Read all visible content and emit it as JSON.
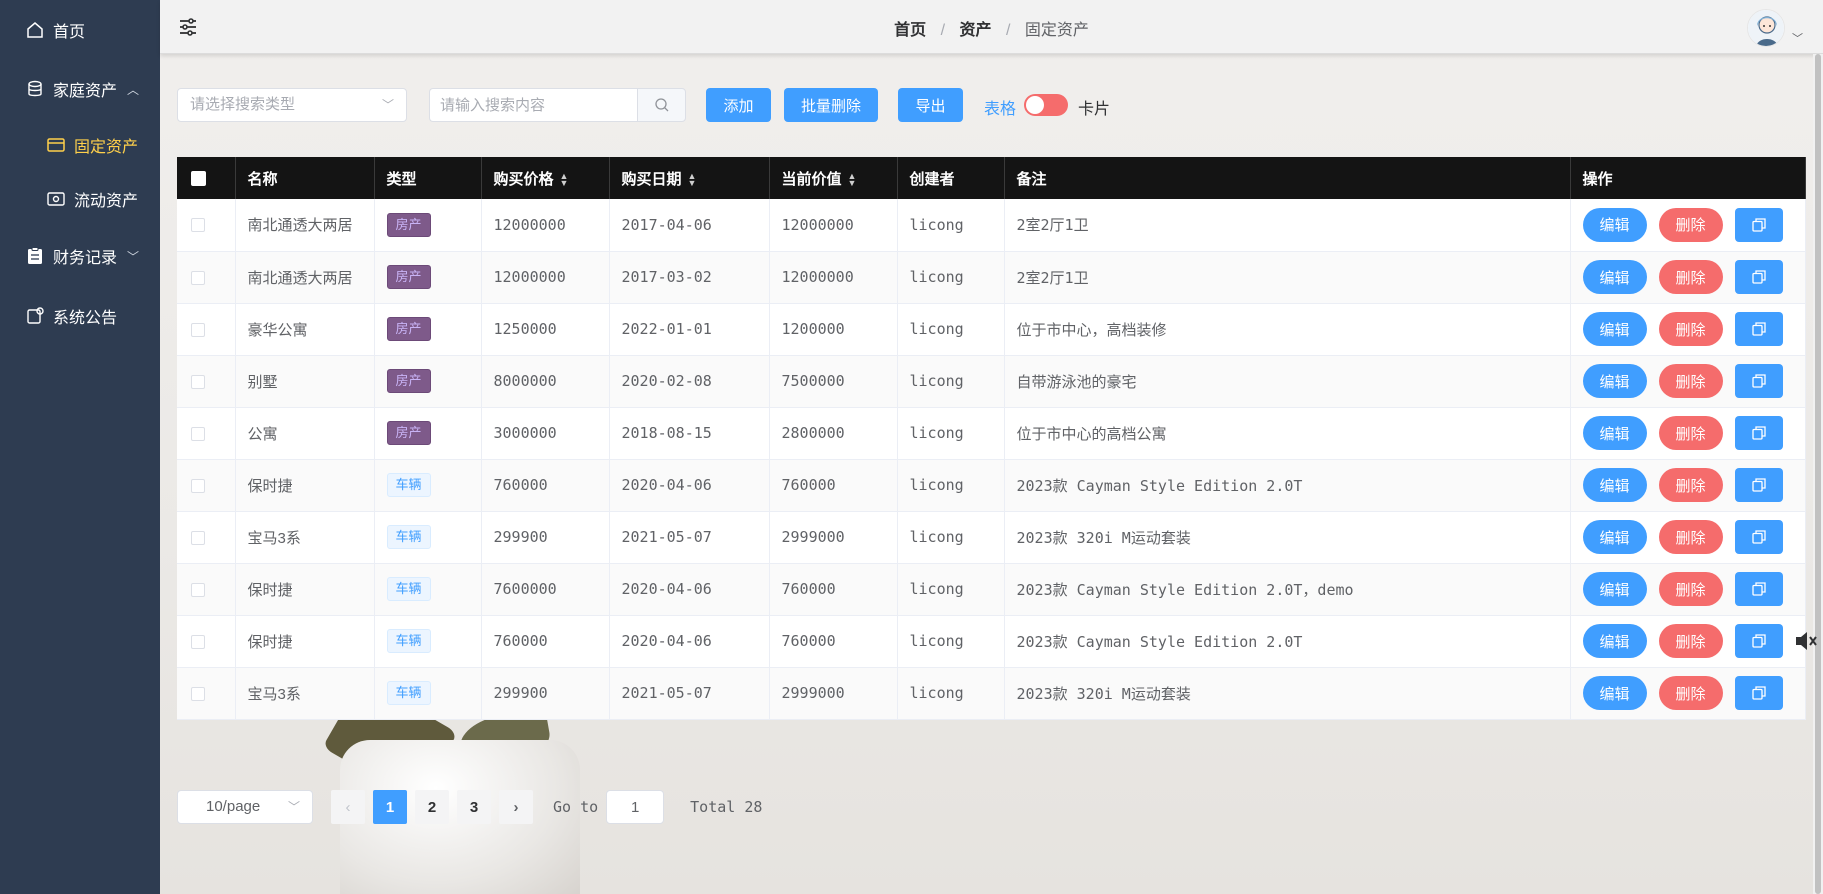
{
  "sidebar": {
    "items": [
      {
        "label": "首页",
        "icon": "home-icon"
      },
      {
        "label": "家庭资产",
        "icon": "database-icon",
        "expanded": true,
        "children": [
          {
            "label": "固定资产",
            "icon": "card-icon",
            "active": true
          },
          {
            "label": "流动资产",
            "icon": "wallet-icon"
          }
        ]
      },
      {
        "label": "财务记录",
        "icon": "clipboard-icon",
        "expanded": false
      },
      {
        "label": "系统公告",
        "icon": "notice-icon"
      }
    ]
  },
  "header": {
    "breadcrumb": [
      "首页",
      "资产",
      "固定资产"
    ],
    "separator": "/"
  },
  "toolbar": {
    "type_select_placeholder": "请选择搜索类型",
    "search_placeholder": "请输入搜索内容",
    "add_label": "添加",
    "batch_delete_label": "批量删除",
    "export_label": "导出",
    "view_table_label": "表格",
    "view_card_label": "卡片"
  },
  "table": {
    "columns": [
      "名称",
      "类型",
      "购买价格",
      "购买日期",
      "当前价值",
      "创建者",
      "备注",
      "操作"
    ],
    "sortable": [
      "购买价格",
      "购买日期",
      "当前价值"
    ],
    "rows": [
      {
        "name": "南北通透大两居",
        "type": "房产",
        "price": "12000000",
        "date": "2017-04-06",
        "value": "12000000",
        "creator": "licong",
        "note": "2室2厅1卫"
      },
      {
        "name": "南北通透大两居",
        "type": "房产",
        "price": "12000000",
        "date": "2017-03-02",
        "value": "12000000",
        "creator": "licong",
        "note": "2室2厅1卫"
      },
      {
        "name": "豪华公寓",
        "type": "房产",
        "price": "1250000",
        "date": "2022-01-01",
        "value": "1200000",
        "creator": "licong",
        "note": "位于市中心，高档装修"
      },
      {
        "name": "别墅",
        "type": "房产",
        "price": "8000000",
        "date": "2020-02-08",
        "value": "7500000",
        "creator": "licong",
        "note": "自带游泳池的豪宅"
      },
      {
        "name": "公寓",
        "type": "房产",
        "price": "3000000",
        "date": "2018-08-15",
        "value": "2800000",
        "creator": "licong",
        "note": "位于市中心的高档公寓"
      },
      {
        "name": "保时捷",
        "type": "车辆",
        "price": "760000",
        "date": "2020-04-06",
        "value": "760000",
        "creator": "licong",
        "note": "2023款 Cayman Style Edition 2.0T"
      },
      {
        "name": "宝马3系",
        "type": "车辆",
        "price": "299900",
        "date": "2021-05-07",
        "value": "2999000",
        "creator": "licong",
        "note": "2023款 320i M运动套装"
      },
      {
        "name": "保时捷",
        "type": "车辆",
        "price": "7600000",
        "date": "2020-04-06",
        "value": "760000",
        "creator": "licong",
        "note": "2023款 Cayman Style Edition 2.0T，demo"
      },
      {
        "name": "保时捷",
        "type": "车辆",
        "price": "760000",
        "date": "2020-04-06",
        "value": "760000",
        "creator": "licong",
        "note": "2023款 Cayman Style Edition 2.0T"
      },
      {
        "name": "宝马3系",
        "type": "车辆",
        "price": "299900",
        "date": "2021-05-07",
        "value": "2999000",
        "creator": "licong",
        "note": "2023款 320i M运动套装"
      }
    ],
    "edit_label": "编辑",
    "delete_label": "删除"
  },
  "pagination": {
    "page_size": "10/page",
    "pages": [
      "1",
      "2",
      "3"
    ],
    "current": "1",
    "goto_label": "Go to",
    "goto_value": "1",
    "total": "Total 28"
  },
  "colors": {
    "sidebar_bg": "#2e3c51",
    "active_nav": "#ffd04b",
    "primary": "#409eff",
    "danger": "#f56c6c",
    "table_header": "#141414"
  }
}
